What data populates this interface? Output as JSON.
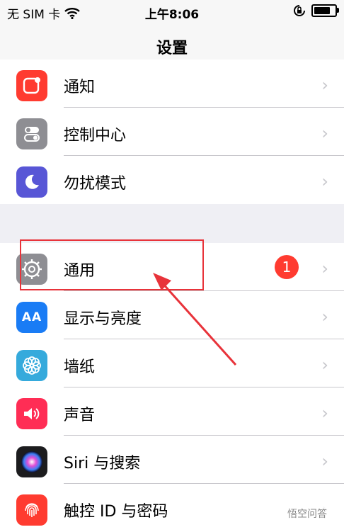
{
  "status": {
    "carrier": "无 SIM 卡",
    "time": "上午8:06",
    "battery_level": 0.78
  },
  "nav": {
    "title": "设置"
  },
  "group1": [
    {
      "label": "通知",
      "icon": "notification-icon",
      "color": "#ff3b30"
    },
    {
      "label": "控制中心",
      "icon": "control-center-icon",
      "color": "#8e8e93"
    },
    {
      "label": "勿扰模式",
      "icon": "moon-icon",
      "color": "#5856d6"
    }
  ],
  "group2": [
    {
      "label": "通用",
      "icon": "gear-icon",
      "color": "#8e8e93",
      "badge": "1"
    },
    {
      "label": "显示与亮度",
      "icon": "display-icon",
      "color": "#1a7cf5"
    },
    {
      "label": "墙纸",
      "icon": "wallpaper-flower-icon",
      "color": "#35aadc"
    },
    {
      "label": "声音",
      "icon": "speaker-icon",
      "color": "#ff2d55"
    },
    {
      "label": "Siri 与搜索",
      "icon": "siri-icon",
      "color": "#1c1c1e"
    },
    {
      "label": "触控 ID 与密码",
      "icon": "fingerprint-icon",
      "color": "#ff3b30"
    }
  ],
  "watermark": "悟空问答",
  "icons_text": {
    "display": "AA"
  }
}
